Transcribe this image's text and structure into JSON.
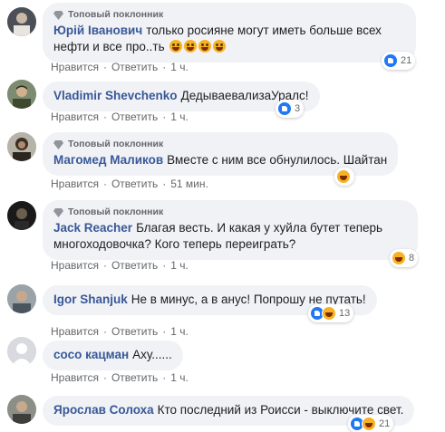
{
  "badge_label": "Топовый поклонник",
  "action_like": "Нравится",
  "action_reply": "Ответить",
  "separator": "·",
  "comments": [
    {
      "author": "Юрій Іванович",
      "text": "только росияне могут иметь больше всех нефти и все про..ть",
      "time": "1 ч.",
      "reactions_count": "21",
      "reaction_types": [
        "like"
      ],
      "emoji_count": 4
    },
    {
      "author": "Vladimir Shevchenko",
      "text": "ДедываевализаУралс!",
      "time": "1 ч.",
      "reactions_count": "3",
      "reaction_types": [
        "like"
      ]
    },
    {
      "author": "Магомед Маликов",
      "text": "Вместе с ним все обнулилось. Шайтан",
      "time": "51 мин.",
      "reactions_count": "",
      "reaction_types": [
        "haha"
      ]
    },
    {
      "author": "Jack Reacher",
      "text": "Благая весть. И какая у хуйла бутет теперь многоходовочка? Кого теперь переиграть?",
      "time": "1 ч.",
      "reactions_count": "8",
      "reaction_types": [
        "haha"
      ]
    },
    {
      "author": "Igor Shanjuk",
      "text": "Не в минус, а в анус! Попрошу не путать!",
      "time": "1 ч.",
      "reactions_count": "13",
      "reaction_types": [
        "like",
        "haha"
      ]
    },
    {
      "author": "сосо кацман",
      "text": "Аху......",
      "time": "1 ч.",
      "reactions_count": "",
      "reaction_types": []
    },
    {
      "author": "Ярослав Солоха",
      "text": "Кто последний из Роисси - выключите свет.",
      "time": "",
      "reactions_count": "21",
      "reaction_types": [
        "like",
        "haha"
      ]
    }
  ],
  "colors": {
    "author": "#385898",
    "bubble": "#f0f2f5",
    "meta": "#65676b",
    "like": "#2078f4",
    "haha": "#f7b125"
  }
}
